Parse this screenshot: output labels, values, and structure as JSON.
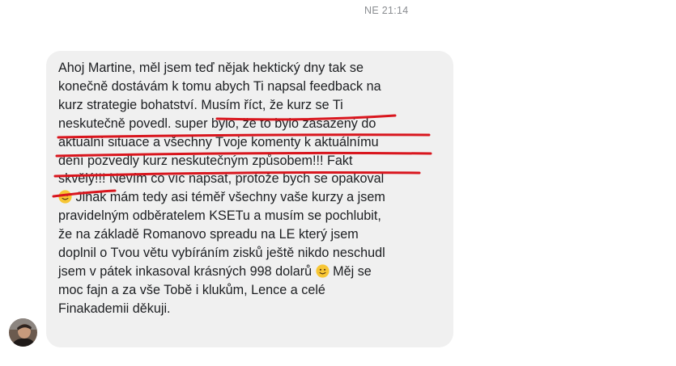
{
  "header": {
    "timestamp": "NE 21:14"
  },
  "message": {
    "lines": [
      "Ahoj Martine, měl jsem teď nějak hektický dny tak se",
      "konečně dostávám k tomu abych Ti napsal feedback na",
      "kurz strategie bohatství. Musím říct, že kurz se Ti",
      "neskutečně povedl. super bylo, že to bylo zasazený do",
      "aktuální situace a všechny Tvoje komenty k aktuálnímu",
      "dění pozvedly kurz neskutečným způsobem!!! Fakt",
      "skvělý!!! Nevím co víc napsat, protože bych se opakoval",
      " Jinak mám tedy asi téměř všechny vaše kurzy a jsem",
      "pravidelným odběratelem KSETu a musím se pochlubit,",
      "že na základě Romanovo spreadu na LE který jsem",
      "doplnil o Tvou větu vybíráním zisků ještě nikdo neschudl",
      "jsem v pátek inkasoval krásných 998 dolarů ",
      " Měj se",
      "moc fajn a za vše Tobě i klukům, Lence a celé",
      "Finakademii děkuji."
    ],
    "emoji_icon": "slightly-smiling-face-icon"
  },
  "colors": {
    "bubble": "#f0f0f0",
    "text": "#1c1e21",
    "timestamp": "#8a8d91",
    "underline": "#d9161e"
  }
}
